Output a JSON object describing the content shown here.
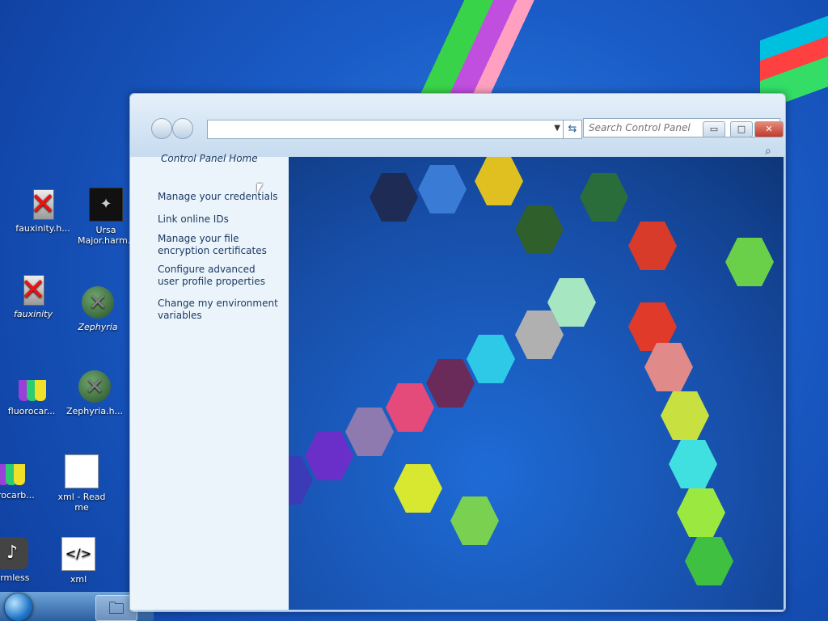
{
  "window": {
    "search_placeholder": "Search Control Panel",
    "address_value": "",
    "controls": {
      "minimize": "▭",
      "maximize": "□",
      "close": "✕"
    }
  },
  "left_pane": {
    "home_link": "Control Panel Home",
    "tasks": [
      "Manage your credentials",
      "Link online IDs",
      "Manage your file encryption certificates",
      "Configure advanced user profile properties",
      "Change my environment variables"
    ]
  },
  "desktop": {
    "icons": [
      {
        "label": "fauxinity.h...",
        "icon": "blocked-server-icon"
      },
      {
        "label": "Ursa Major.harm...",
        "icon": "constellation-icon"
      },
      {
        "label": "fauxinity",
        "icon": "blocked-server-shield-icon"
      },
      {
        "label": "Zephyria",
        "icon": "green-x-shield-icon"
      },
      {
        "label": "fluorocar...",
        "icon": "flasks-icon"
      },
      {
        "label": "Zephyria.h...",
        "icon": "green-x-icon"
      },
      {
        "label": "uorocarb...",
        "icon": "flasks-shield-icon"
      },
      {
        "label": "xml - Read me",
        "icon": "text-file-icon"
      },
      {
        "label": "armless",
        "icon": "media-player-icon"
      },
      {
        "label": "xml",
        "icon": "xml-file-icon"
      }
    ]
  },
  "taskbar": {
    "start_label": "Start",
    "pinned": "explorer-folder-icon"
  },
  "colors": {
    "accent": "#1c3a64",
    "close_red": "#c0392b",
    "desktop_blue": "#1a5cc7"
  }
}
